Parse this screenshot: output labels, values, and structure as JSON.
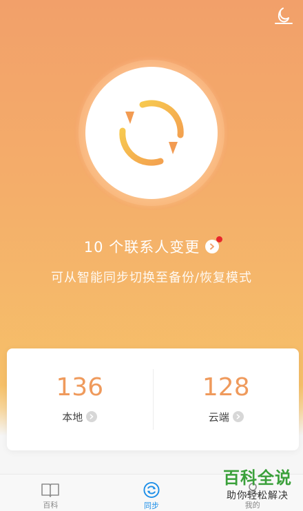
{
  "header": {
    "night_mode_icon": "moon-icon"
  },
  "sync": {
    "icon": "sync-arrows-icon",
    "change_text": "10 个联系人变更",
    "change_icon": "chevron-right-icon",
    "has_notification": true,
    "hint": "可从智能同步切换至备份/恢复模式"
  },
  "stats": {
    "local": {
      "count": "136",
      "label": "本地",
      "icon": "chevron-right-icon"
    },
    "cloud": {
      "count": "128",
      "label": "云端",
      "icon": "chevron-right-icon"
    }
  },
  "tabs": [
    {
      "label": "百科",
      "icon": "book-icon",
      "active": false
    },
    {
      "label": "同步",
      "icon": "sync-icon",
      "active": true
    },
    {
      "label": "我的",
      "icon": "person-icon",
      "active": false
    }
  ],
  "watermark": {
    "title": "百科全说",
    "subtitle": "助你轻松解决"
  },
  "colors": {
    "accent_orange": "#ef9a5c",
    "active_tab_blue": "#1e8fe8",
    "notification_red": "#e8262b"
  }
}
